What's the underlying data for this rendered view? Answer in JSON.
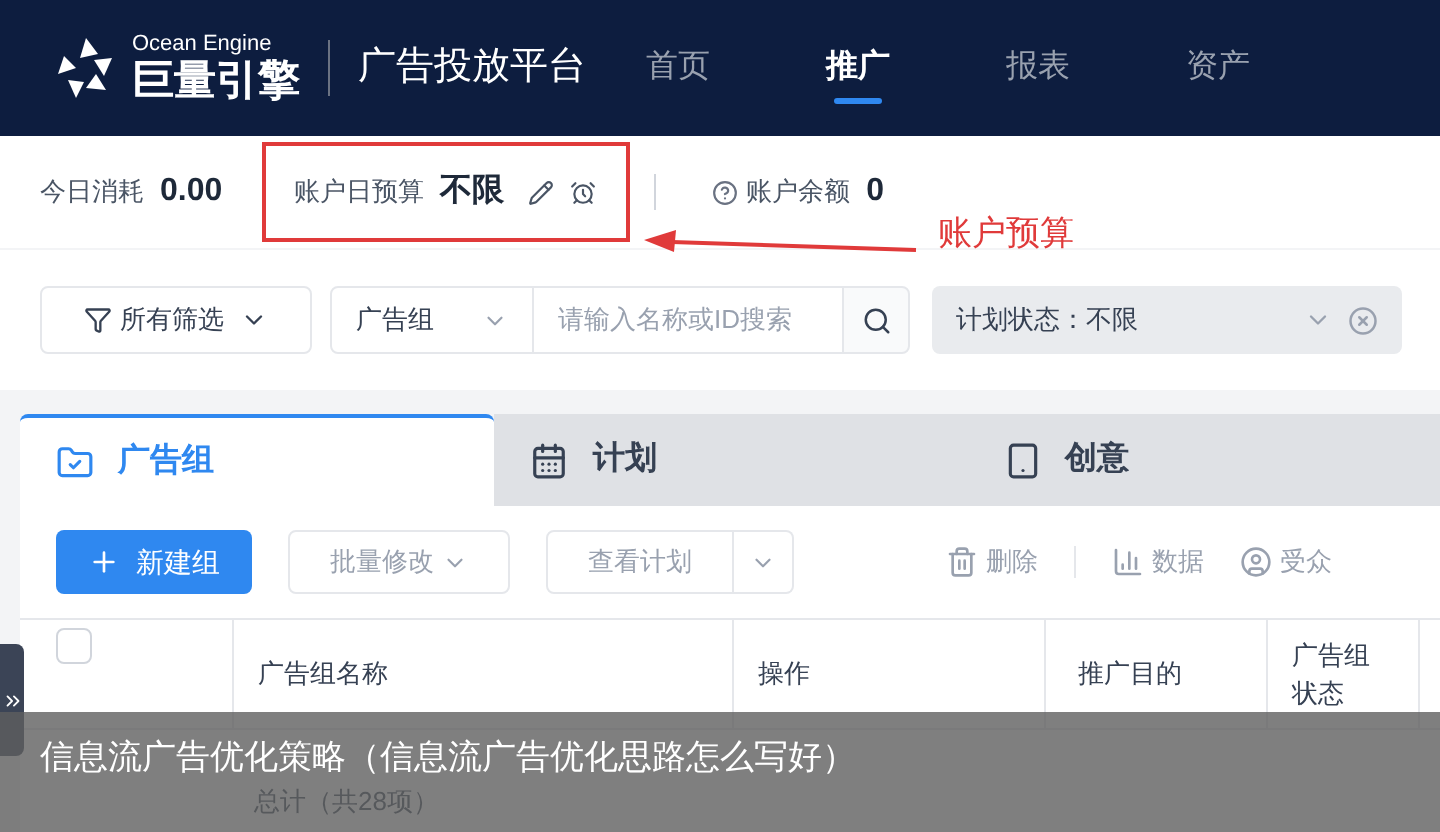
{
  "header": {
    "logo_en": "Ocean Engine",
    "logo_cn": "巨量引擎",
    "platform": "广告投放平台",
    "nav": [
      {
        "label": "首页",
        "selected": false
      },
      {
        "label": "推广",
        "selected": true
      },
      {
        "label": "报表",
        "selected": false
      },
      {
        "label": "资产",
        "selected": false
      }
    ]
  },
  "stats": {
    "today_spend": {
      "label": "今日消耗",
      "value": "0.00"
    },
    "daily_budget": {
      "label": "账户日预算",
      "value": "不限"
    },
    "balance": {
      "label": "账户余额",
      "value": "0"
    }
  },
  "annotation": {
    "label": "账户预算"
  },
  "filters": {
    "all_filters": "所有筛选",
    "scope": "广告组",
    "search": {
      "placeholder": "请输入名称或ID搜索"
    },
    "status": "计划状态：不限"
  },
  "tabs": [
    {
      "label": "广告组",
      "selected": true
    },
    {
      "label": "计划",
      "selected": false
    },
    {
      "label": "创意",
      "selected": false
    }
  ],
  "toolbar": [
    {
      "label": "新建组",
      "kind": "primary",
      "disabled": false
    },
    {
      "label": "批量修改",
      "kind": "dropdown",
      "disabled": true
    },
    {
      "label": "查看计划",
      "kind": "split",
      "disabled": true
    },
    {
      "label": "删除",
      "kind": "trash",
      "disabled": true
    },
    {
      "label": "数据",
      "kind": "chart",
      "disabled": true
    },
    {
      "label": "受众",
      "kind": "audience",
      "disabled": true
    }
  ],
  "table": {
    "select_all_checked": false,
    "columns": [
      "广告组名称",
      "操作",
      "推广目的",
      "广告组状态"
    ],
    "total": "总计（共28项）"
  },
  "caption": "信息流广告优化策略（信息流广告优化思路怎么写好）"
}
